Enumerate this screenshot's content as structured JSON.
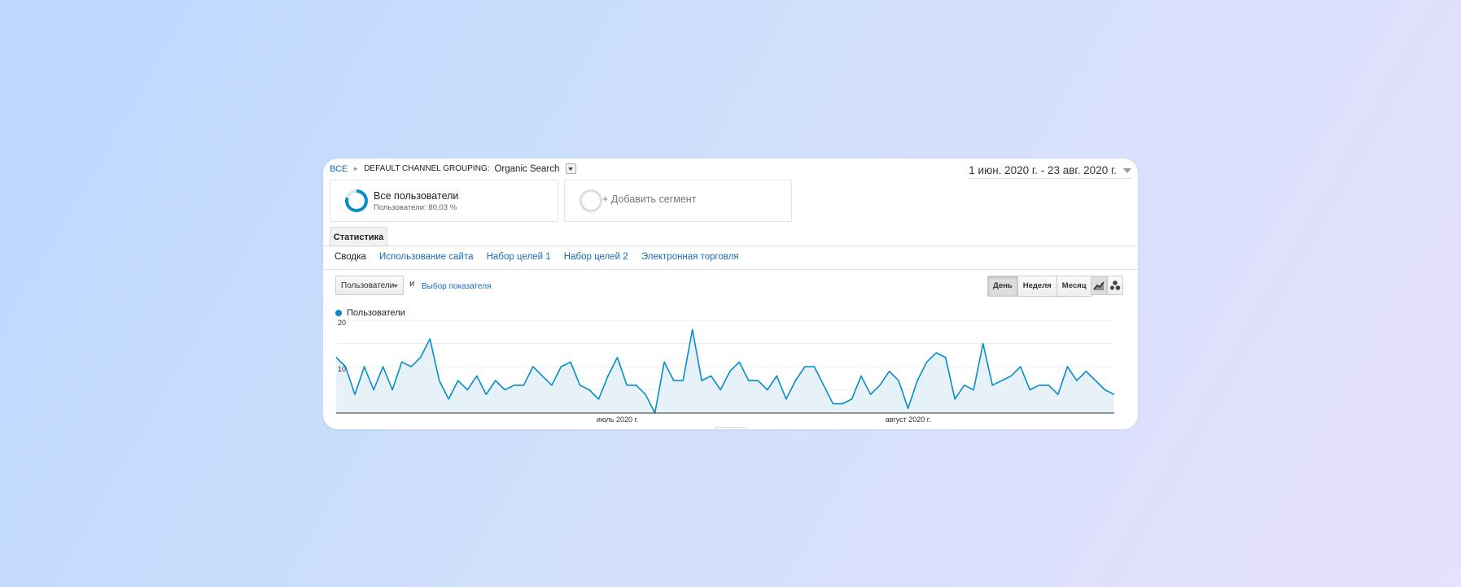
{
  "breadcrumb": {
    "root": "ВСЕ",
    "dimension": "DEFAULT CHANNEL GROUPING:",
    "value": "Organic Search"
  },
  "date_range": "1 июн. 2020 г. - 23 авг. 2020 г.",
  "segments": {
    "active_title": "Все пользователи",
    "active_sub": "Пользователи: 80,03 %",
    "add_label": "+ Добавить сегмент"
  },
  "tab": "Статистика",
  "subnav": [
    "Сводка",
    "Использование сайта",
    "Набор целей 1",
    "Набор целей 2",
    "Электронная торговля"
  ],
  "metric_select": "Пользователи",
  "and_label": "и",
  "pick_metric": "Выбор показателя",
  "granularity": [
    "День",
    "Неделя",
    "Месяц"
  ],
  "granularity_selected": "День",
  "icons": {
    "line_chart_view": "line-chart-icon",
    "motion_chart_view": "bubble-chart-icon"
  },
  "colors": {
    "series": "#058dc7",
    "link": "#1a6bb8"
  },
  "chart_data": {
    "type": "area",
    "series": [
      {
        "name": "Пользователи",
        "values": [
          12,
          10,
          4,
          10,
          5,
          10,
          5,
          11,
          10,
          12,
          16,
          7,
          3,
          7,
          5,
          8,
          4,
          7,
          5,
          6,
          6,
          10,
          8,
          6,
          10,
          11,
          6,
          5,
          3,
          8,
          12,
          6,
          6,
          4,
          0,
          11,
          7,
          7,
          18,
          7,
          8,
          5,
          9,
          11,
          7,
          7,
          5,
          8,
          3,
          7,
          10,
          10,
          6,
          2,
          2,
          3,
          8,
          4,
          6,
          9,
          7,
          1,
          7,
          11,
          13,
          12,
          3,
          6,
          5,
          15,
          6,
          7,
          8,
          10,
          5,
          6,
          6,
          4,
          10,
          7,
          9,
          7,
          5,
          4
        ]
      }
    ],
    "start_date": "2020-06-01",
    "end_date": "2020-08-23",
    "x_tick_labels": [
      "июль 2020 г.",
      "август 2020 г."
    ],
    "y_tick_labels": [
      "20",
      "10"
    ],
    "ylim": [
      0,
      20
    ],
    "grid": true,
    "legend": "top-left"
  }
}
